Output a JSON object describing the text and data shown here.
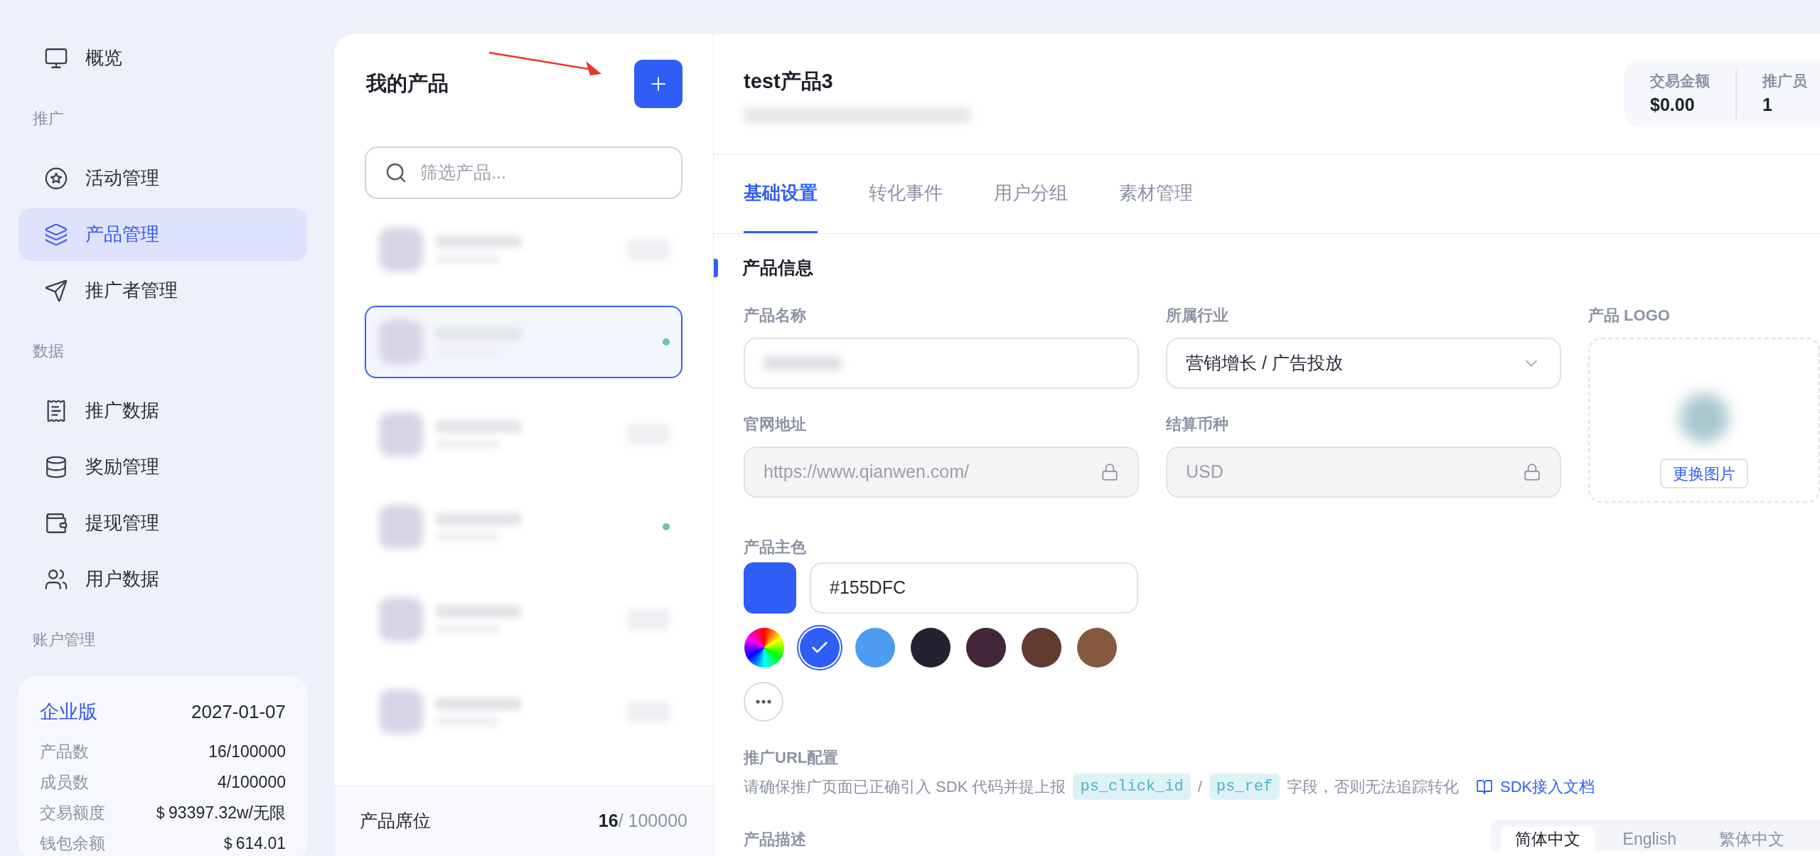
{
  "sidebar": {
    "sections": [
      {
        "items": [
          {
            "label": "概览",
            "selected": false
          }
        ]
      },
      {
        "heading": "推广",
        "items": [
          {
            "label": "活动管理",
            "selected": false
          },
          {
            "label": "产品管理",
            "selected": true
          },
          {
            "label": "推广者管理",
            "selected": false
          }
        ]
      },
      {
        "heading": "数据",
        "items": [
          {
            "label": "推广数据",
            "selected": false
          },
          {
            "label": "奖励管理",
            "selected": false
          },
          {
            "label": "提现管理",
            "selected": false
          },
          {
            "label": "用户数据",
            "selected": false
          }
        ]
      },
      {
        "heading": "账户管理"
      }
    ],
    "plan_card": {
      "plan": "企业版",
      "expires": "2027-01-07",
      "rows": [
        {
          "label": "产品数",
          "value": "16/100000"
        },
        {
          "label": "成员数",
          "value": "4/100000"
        },
        {
          "label": "交易额度",
          "value": "＄93397.32w/无限"
        },
        {
          "label": "钱包余额",
          "value": "＄614.01"
        }
      ]
    }
  },
  "product_list": {
    "title": "我的产品",
    "search": {
      "placeholder": "筛选产品..."
    },
    "items": [
      {
        "selected": false,
        "status_dot": false
      },
      {
        "selected": true,
        "status_dot": true
      },
      {
        "selected": false,
        "status_dot": false
      },
      {
        "selected": false,
        "status_dot": true
      },
      {
        "selected": false,
        "status_dot": false
      },
      {
        "selected": false,
        "status_dot": false
      }
    ],
    "footer": {
      "label": "产品席位",
      "used": "16",
      "total": "/ 100000"
    }
  },
  "product": {
    "title": "test产品3",
    "stats": [
      {
        "label": "交易金额",
        "value": "$0.00"
      },
      {
        "label": "推广员",
        "value": "1"
      }
    ],
    "tabs": [
      {
        "label": "基础设置",
        "selected": true
      },
      {
        "label": "转化事件",
        "selected": false
      },
      {
        "label": "用户分组",
        "selected": false
      },
      {
        "label": "素材管理",
        "selected": false
      }
    ],
    "section_title": "产品信息",
    "fields": [
      {
        "label": "产品名称",
        "kind": "redacted"
      },
      {
        "label": "所属行业",
        "kind": "select",
        "value": "营销增长 / 广告投放"
      },
      {
        "label": "官网地址",
        "kind": "locked",
        "value": "https://www.qianwen.com/"
      },
      {
        "label": "结算币种",
        "kind": "locked",
        "value": "USD"
      }
    ],
    "logo": {
      "label": "产品 LOGO",
      "button": "更换图片"
    },
    "main_color": {
      "label": "产品主色",
      "value": "#155DFC",
      "swatches": [
        {
          "kind": "wheel",
          "selected": false
        },
        {
          "kind": "color",
          "color": "#2f5ef6",
          "selected": true
        },
        {
          "kind": "color",
          "color": "#4d9cf2",
          "selected": false
        },
        {
          "kind": "color",
          "color": "#222233",
          "selected": false
        },
        {
          "kind": "color",
          "color": "#42263a",
          "selected": false
        },
        {
          "kind": "color",
          "color": "#5e3a2f",
          "selected": false
        },
        {
          "kind": "color",
          "color": "#85593e",
          "selected": false
        },
        {
          "kind": "more",
          "selected": false
        }
      ]
    },
    "url_config": {
      "title": "推广URL配置",
      "hint_before": "请确保推广页面已正确引入 SDK 代码并提上报",
      "code_1": "ps_click_id",
      "separator": "/",
      "code_2": "ps_ref",
      "hint_after": "字段，否则无法追踪转化",
      "link": "SDK接入文档"
    },
    "description": {
      "label": "产品描述",
      "languages": [
        {
          "label": "简体中文",
          "selected": true
        },
        {
          "label": "English",
          "selected": false
        },
        {
          "label": "繁体中文",
          "selected": false
        }
      ]
    }
  }
}
